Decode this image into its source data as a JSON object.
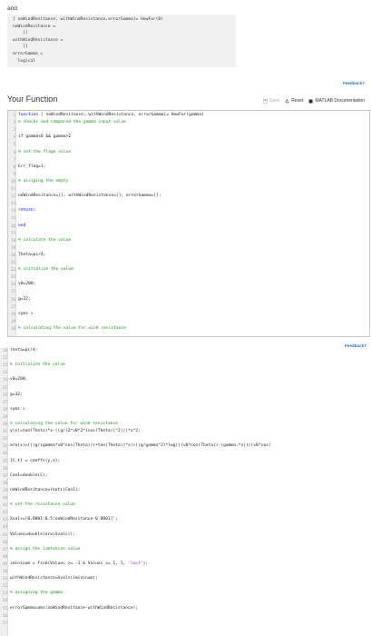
{
  "intro_text": "and",
  "output": {
    "lines": [
      "[ noWindResitance, withWindResistance,errorGamma]= HowFar(0)",
      "noWindResitance =",
      "    []",
      "withWindResistance =",
      "    []",
      "errorGamma =",
      "  logical"
    ]
  },
  "feedback_label": "Feedback?",
  "section_title": "Your Function",
  "toolbar": {
    "save_label": "Save",
    "reset_label": "Reset",
    "docs_label": "MATLAB Documentation"
  },
  "editor_top": {
    "lines": [
      {
        "n": "1",
        "parts": [
          {
            "t": "function ",
            "c": "kw"
          },
          {
            "t": "[ noWindResitance, withWindResistance, errorGamma]= HowFar(gamma)",
            "c": "tx"
          }
        ]
      },
      {
        "n": "2",
        "parts": [
          {
            "t": "% checks and compared the gamma input value",
            "c": "cm"
          }
        ]
      },
      {
        "n": "3",
        "parts": []
      },
      {
        "n": "4",
        "parts": [
          {
            "t": "if ",
            "c": "kw"
          },
          {
            "t": "gamma<0 && gamma>2",
            "c": "tx"
          }
        ]
      },
      {
        "n": "5",
        "parts": []
      },
      {
        "n": "6",
        "parts": [
          {
            "t": "% set the flage value",
            "c": "cm"
          }
        ]
      },
      {
        "n": "7",
        "parts": []
      },
      {
        "n": "8",
        "parts": [
          {
            "t": "Err_flag=1;",
            "c": "tx"
          }
        ]
      },
      {
        "n": "9",
        "parts": []
      },
      {
        "n": "10",
        "parts": [
          {
            "t": "% assiging the empty",
            "c": "cm"
          }
        ]
      },
      {
        "n": "11",
        "parts": []
      },
      {
        "n": "12",
        "parts": [
          {
            "t": "noWindResitance=[]; withWindResistance=[]; errorGamma=[];",
            "c": "tx"
          }
        ]
      },
      {
        "n": "13",
        "parts": []
      },
      {
        "n": "14",
        "parts": [
          {
            "t": "return;",
            "c": "kw"
          }
        ]
      },
      {
        "n": "15",
        "parts": []
      },
      {
        "n": "16",
        "parts": [
          {
            "t": "end",
            "c": "kw"
          }
        ]
      },
      {
        "n": "17",
        "parts": []
      },
      {
        "n": "18",
        "parts": [
          {
            "t": "% calculate the value",
            "c": "cm"
          }
        ]
      },
      {
        "n": "19",
        "parts": []
      },
      {
        "n": "20",
        "parts": [
          {
            "t": "Theta=pi/4;",
            "c": "tx"
          }
        ]
      },
      {
        "n": "21",
        "parts": []
      },
      {
        "n": "22",
        "parts": [
          {
            "t": "% initialize the value",
            "c": "cm"
          }
        ]
      },
      {
        "n": "23",
        "parts": []
      },
      {
        "n": "24",
        "parts": [
          {
            "t": "v0=200;",
            "c": "tx"
          }
        ]
      },
      {
        "n": "25",
        "parts": []
      },
      {
        "n": "26",
        "parts": [
          {
            "t": "g=32;",
            "c": "tx"
          }
        ]
      },
      {
        "n": "27",
        "parts": []
      },
      {
        "n": "28",
        "parts": [
          {
            "t": "syms ",
            "c": "tx"
          },
          {
            "t": "x",
            "c": "pu"
          }
        ]
      },
      {
        "n": "29",
        "parts": []
      },
      {
        "n": "30",
        "parts": [
          {
            "t": "% calculating the value for wind resistance",
            "c": "cm"
          }
        ]
      }
    ]
  },
  "editor_bottom": {
    "lines": [
      {
        "n": "20",
        "parts": [
          {
            "t": "Theta=pi/4;",
            "c": "tx"
          }
        ]
      },
      {
        "n": "21",
        "parts": []
      },
      {
        "n": "22",
        "parts": [
          {
            "t": "% initialize the value",
            "c": "cm"
          }
        ]
      },
      {
        "n": "23",
        "parts": []
      },
      {
        "n": "24",
        "parts": [
          {
            "t": "v0=200;",
            "c": "tx"
          }
        ]
      },
      {
        "n": "25",
        "parts": []
      },
      {
        "n": "26",
        "parts": [
          {
            "t": "g=32;",
            "c": "tx"
          }
        ]
      },
      {
        "n": "27",
        "parts": []
      },
      {
        "n": "28",
        "parts": [
          {
            "t": "syms ",
            "c": "tx"
          },
          {
            "t": "x",
            "c": "pu"
          }
        ]
      },
      {
        "n": "29",
        "parts": []
      },
      {
        "n": "30",
        "parts": [
          {
            "t": "% calculating the value for wind resistance",
            "c": "cm"
          }
        ]
      },
      {
        "n": "31",
        "parts": [
          {
            "t": "y(x)=tan(Theta)*x-((g/(2*v0^2*(cos(Theta))^2)))*x^2;",
            "c": "tx"
          }
        ]
      },
      {
        "n": "32",
        "parts": []
      },
      {
        "n": "33",
        "parts": [
          {
            "t": "arw(x)=(((g/(gamma*v0*cos(Theta)))+tan(Theta))*x)+((g/gamma^2)*log(((v0*cos(Theta))-(gamma.*x))/(v0*cos(",
            "c": "tx"
          }
        ]
      },
      {
        "n": "34",
        "parts": []
      },
      {
        "n": "35",
        "parts": [
          {
            "t": "[C,t] = coeffs(y,x);",
            "c": "tx"
          }
        ]
      },
      {
        "n": "36",
        "parts": []
      },
      {
        "n": "37",
        "parts": [
          {
            "t": "Can1=double(C);",
            "c": "tx"
          }
        ]
      },
      {
        "n": "38",
        "parts": []
      },
      {
        "n": "39",
        "parts": [
          {
            "t": "noWindResitance=roots(Can1);",
            "c": "tx"
          }
        ]
      },
      {
        "n": "40",
        "parts": []
      },
      {
        "n": "41",
        "parts": [
          {
            "t": "% set the resistance value",
            "c": "cm"
          }
        ]
      },
      {
        "n": "42",
        "parts": []
      },
      {
        "n": "43",
        "parts": [
          {
            "t": "Xvals=[0.0001:0.5:noWindResitance-0.0001]';",
            "c": "tx"
          }
        ]
      },
      {
        "n": "44",
        "parts": []
      },
      {
        "n": "45",
        "parts": [
          {
            "t": "Values=double(arw(Xvals));",
            "c": "tx"
          }
        ]
      },
      {
        "n": "46",
        "parts": []
      },
      {
        "n": "47",
        "parts": [
          {
            "t": "% assign the limtation value",
            "c": "cm"
          }
        ]
      },
      {
        "n": "48",
        "parts": []
      },
      {
        "n": "49",
        "parts": [
          {
            "t": "imininum = find(Values >= -1 & Values <= 1, 1, ",
            "c": "tx"
          },
          {
            "t": "'last'",
            "c": "str"
          },
          {
            "t": ");",
            "c": "tx"
          }
        ]
      },
      {
        "n": "50",
        "parts": []
      },
      {
        "n": "51",
        "parts": [
          {
            "t": "withWindResistance=Xvals(imininum);",
            "c": "tx"
          }
        ]
      },
      {
        "n": "52",
        "parts": []
      },
      {
        "n": "53",
        "parts": [
          {
            "t": "% assigning the gamma",
            "c": "cm"
          }
        ]
      },
      {
        "n": "54",
        "parts": []
      },
      {
        "n": "55",
        "parts": [
          {
            "t": "errorGamma=abs(noWindResitance-withWindResistance);",
            "c": "tx"
          }
        ]
      },
      {
        "n": "56",
        "parts": []
      },
      {
        "n": "57",
        "parts": []
      }
    ]
  }
}
